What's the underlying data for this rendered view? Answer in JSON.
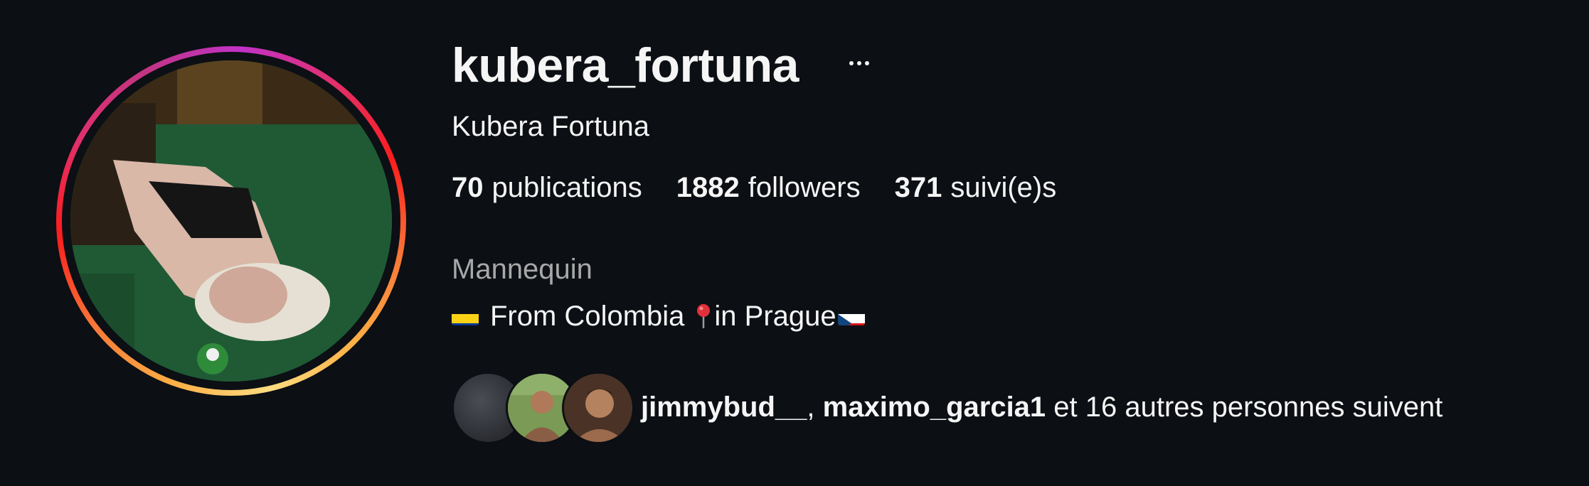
{
  "profile": {
    "username": "kubera_fortuna",
    "full_name": "Kubera Fortuna",
    "more_icon": "more-horizontal-icon"
  },
  "stats": {
    "posts_count": "70",
    "posts_label": "publications",
    "followers_count": "1882",
    "followers_label": "followers",
    "following_count": "371",
    "following_label": "suivi(e)s"
  },
  "bio": {
    "category": "Mannequin",
    "line_from": "From Colombia",
    "line_in": "in Prague",
    "flag_1": "colombia-flag-icon",
    "pin": "round-pushpin-icon",
    "flag_2": "czech-flag-icon"
  },
  "followed_by": {
    "user_1": "jimmybud__",
    "separator": ",",
    "user_2": "maximo_garcia1",
    "rest": "et 16 autres personnes suivent"
  },
  "colors": {
    "background": "#0c0f14",
    "text": "#f5f5f5",
    "muted": "#a8a8a8"
  }
}
